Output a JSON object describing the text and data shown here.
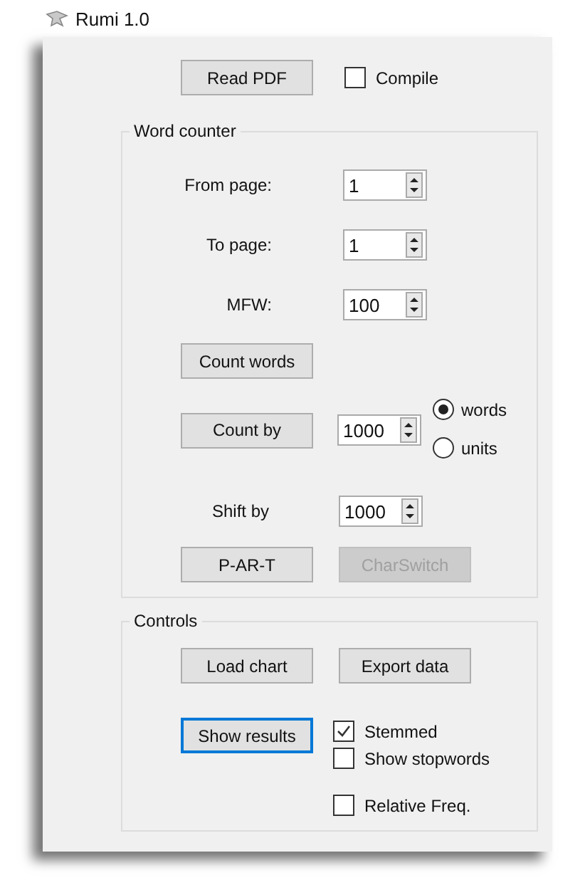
{
  "window": {
    "title": "Rumi 1.0"
  },
  "read_pdf": {
    "label": "Read PDF"
  },
  "compile": {
    "label": "Compile",
    "checked": false
  },
  "word_counter": {
    "title": "Word counter",
    "fields": [
      {
        "label": "From page:",
        "value": "1"
      },
      {
        "label": "To page:",
        "value": "1"
      },
      {
        "label": "MFW:",
        "value": "100"
      }
    ],
    "count_words": {
      "label": "Count words"
    },
    "count_by": {
      "label": "Count by",
      "value": "1000"
    },
    "units": [
      {
        "label": "words",
        "selected": true
      },
      {
        "label": "units",
        "selected": false
      }
    ],
    "shift_by": {
      "label": "Shift by",
      "value": "1000"
    },
    "buttons": [
      {
        "label": "P-AR-T",
        "disabled": false
      },
      {
        "label": "CharSwitch",
        "disabled": true
      }
    ]
  },
  "controls": {
    "title": "Controls",
    "buttons": [
      {
        "label": "Load chart"
      },
      {
        "label": "Export data"
      }
    ],
    "show_results": {
      "label": "Show results",
      "focused": true
    },
    "checkboxes": [
      {
        "label": "Stemmed",
        "checked": true
      },
      {
        "label": "Show stopwords",
        "checked": false
      },
      {
        "label": "Relative Freq.",
        "checked": false
      }
    ]
  }
}
